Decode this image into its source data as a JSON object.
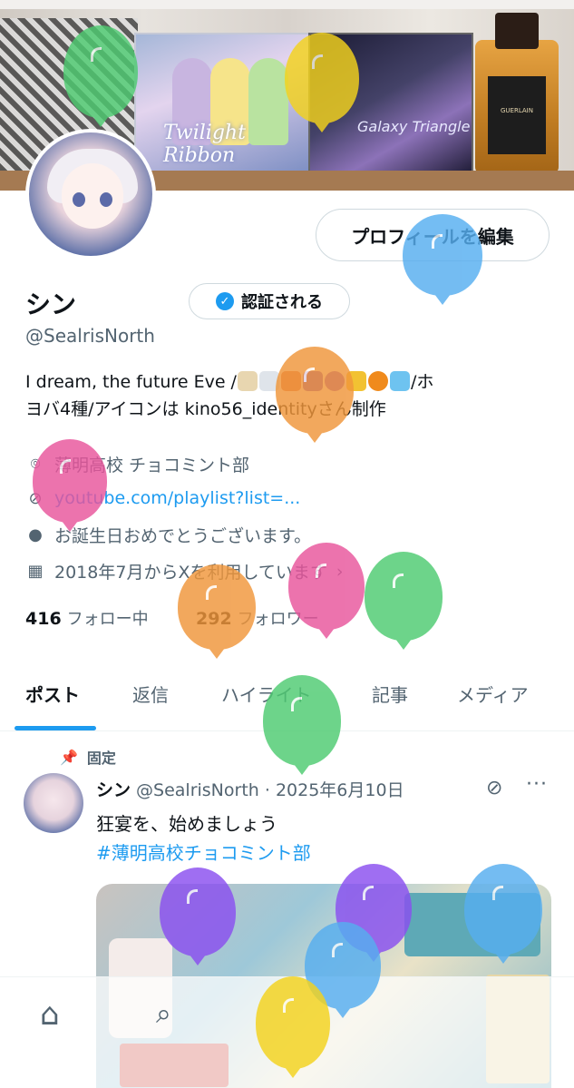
{
  "banner": {
    "cd1_title": "Twilight Ribbon",
    "cd2_title": "Galaxy Triangle",
    "bottle_label": "GUERLAIN"
  },
  "profile": {
    "edit_button_label": "プロフィールを編集",
    "display_name": "シン",
    "verify_button_label": "認証される",
    "handle": "@SealrisNorth",
    "bio_part1": "I dream, the future Eve /",
    "bio_part2": "/ホ",
    "bio_line2": "ヨバ4種/アイコンは kino56_identityさん制作",
    "location": "薄明高校 チョコミント部",
    "link": "youtube.com/playlist?list=...",
    "birthday": "お誕生日おめでとうございます。",
    "joined": "2018年7月からXを利用しています",
    "following_count": "416",
    "following_label": "フォロー中",
    "followers_count": "292",
    "followers_label": "フォロワー"
  },
  "tabs": [
    {
      "label": "ポスト"
    },
    {
      "label": "返信"
    },
    {
      "label": "ハイライト"
    },
    {
      "label": "記事"
    },
    {
      "label": "メディア"
    }
  ],
  "post": {
    "pinned_label": "固定",
    "author_name": "シン",
    "author_handle": "@SealrisNorth",
    "date": "· 2025年6月10日",
    "text": "狂宴を、始めましょう",
    "hashtag": "#薄明高校チョコミント部"
  },
  "icons": {
    "location": "location-pin-icon",
    "link": "link-icon",
    "birthday": "balloon-icon",
    "calendar": "calendar-icon",
    "pin": "pin-icon",
    "home": "home-icon",
    "search": "search-icon",
    "grok": "grok-icon",
    "more": "more-icon"
  },
  "colors": {
    "accent": "#1d9bf0",
    "text": "#0f1419",
    "muted": "#536471",
    "balloons": [
      "#4ecb71",
      "#f4d31c",
      "#56aef0",
      "#f0963a",
      "#e8559c",
      "#f0963a",
      "#e8559c",
      "#4ecb71",
      "#4ecb71",
      "#8a4ff0",
      "#8a4ff0",
      "#56aef0",
      "#56aef0",
      "#f4d31c"
    ]
  }
}
